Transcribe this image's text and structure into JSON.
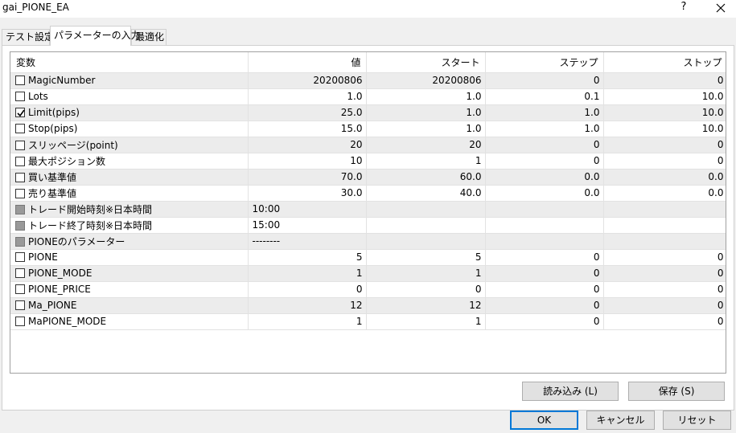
{
  "window": {
    "title": "gai_PIONE_EA",
    "help": "?"
  },
  "tabs": [
    "テスト設定",
    "パラメーターの入力",
    "最適化"
  ],
  "columns": [
    "変数",
    "値",
    "スタート",
    "ステップ",
    "ストップ"
  ],
  "rows": [
    {
      "name": "MagicNumber",
      "checked": false,
      "disabled": false,
      "value": "20200806",
      "start": "20200806",
      "step": "0",
      "stop": "0"
    },
    {
      "name": "Lots",
      "checked": false,
      "disabled": false,
      "value": "1.0",
      "start": "1.0",
      "step": "0.1",
      "stop": "10.0"
    },
    {
      "name": "Limit(pips)",
      "checked": true,
      "disabled": false,
      "value": "25.0",
      "start": "1.0",
      "step": "1.0",
      "stop": "10.0"
    },
    {
      "name": "Stop(pips)",
      "checked": false,
      "disabled": false,
      "value": "15.0",
      "start": "1.0",
      "step": "1.0",
      "stop": "10.0"
    },
    {
      "name": "スリッページ(point)",
      "checked": false,
      "disabled": false,
      "value": "20",
      "start": "20",
      "step": "0",
      "stop": "0"
    },
    {
      "name": "最大ポジション数",
      "checked": false,
      "disabled": false,
      "value": "10",
      "start": "1",
      "step": "0",
      "stop": "0"
    },
    {
      "name": "買い基準値",
      "checked": false,
      "disabled": false,
      "value": "70.0",
      "start": "60.0",
      "step": "0.0",
      "stop": "0.0"
    },
    {
      "name": "売り基準値",
      "checked": false,
      "disabled": false,
      "value": "30.0",
      "start": "40.0",
      "step": "0.0",
      "stop": "0.0"
    },
    {
      "name": "トレード開始時刻※日本時間",
      "checked": false,
      "disabled": true,
      "value": "10:00",
      "start": "",
      "step": "",
      "stop": ""
    },
    {
      "name": "トレード終了時刻※日本時間",
      "checked": false,
      "disabled": true,
      "value": "15:00",
      "start": "",
      "step": "",
      "stop": ""
    },
    {
      "name": "PIONEのパラメーター",
      "checked": false,
      "disabled": true,
      "value": "--------",
      "start": "",
      "step": "",
      "stop": ""
    },
    {
      "name": "PIONE",
      "checked": false,
      "disabled": false,
      "value": "5",
      "start": "5",
      "step": "0",
      "stop": "0"
    },
    {
      "name": "PIONE_MODE",
      "checked": false,
      "disabled": false,
      "value": "1",
      "start": "1",
      "step": "0",
      "stop": "0"
    },
    {
      "name": "PIONE_PRICE",
      "checked": false,
      "disabled": false,
      "value": "0",
      "start": "0",
      "step": "0",
      "stop": "0"
    },
    {
      "name": "Ma_PIONE",
      "checked": false,
      "disabled": false,
      "value": "12",
      "start": "12",
      "step": "0",
      "stop": "0"
    },
    {
      "name": "MaPIONE_MODE",
      "checked": false,
      "disabled": false,
      "value": "1",
      "start": "1",
      "step": "0",
      "stop": "0"
    }
  ],
  "buttons": {
    "load": "読み込み (L)",
    "save": "保存 (S)",
    "ok": "OK",
    "cancel": "キャンセル",
    "reset": "リセット"
  }
}
